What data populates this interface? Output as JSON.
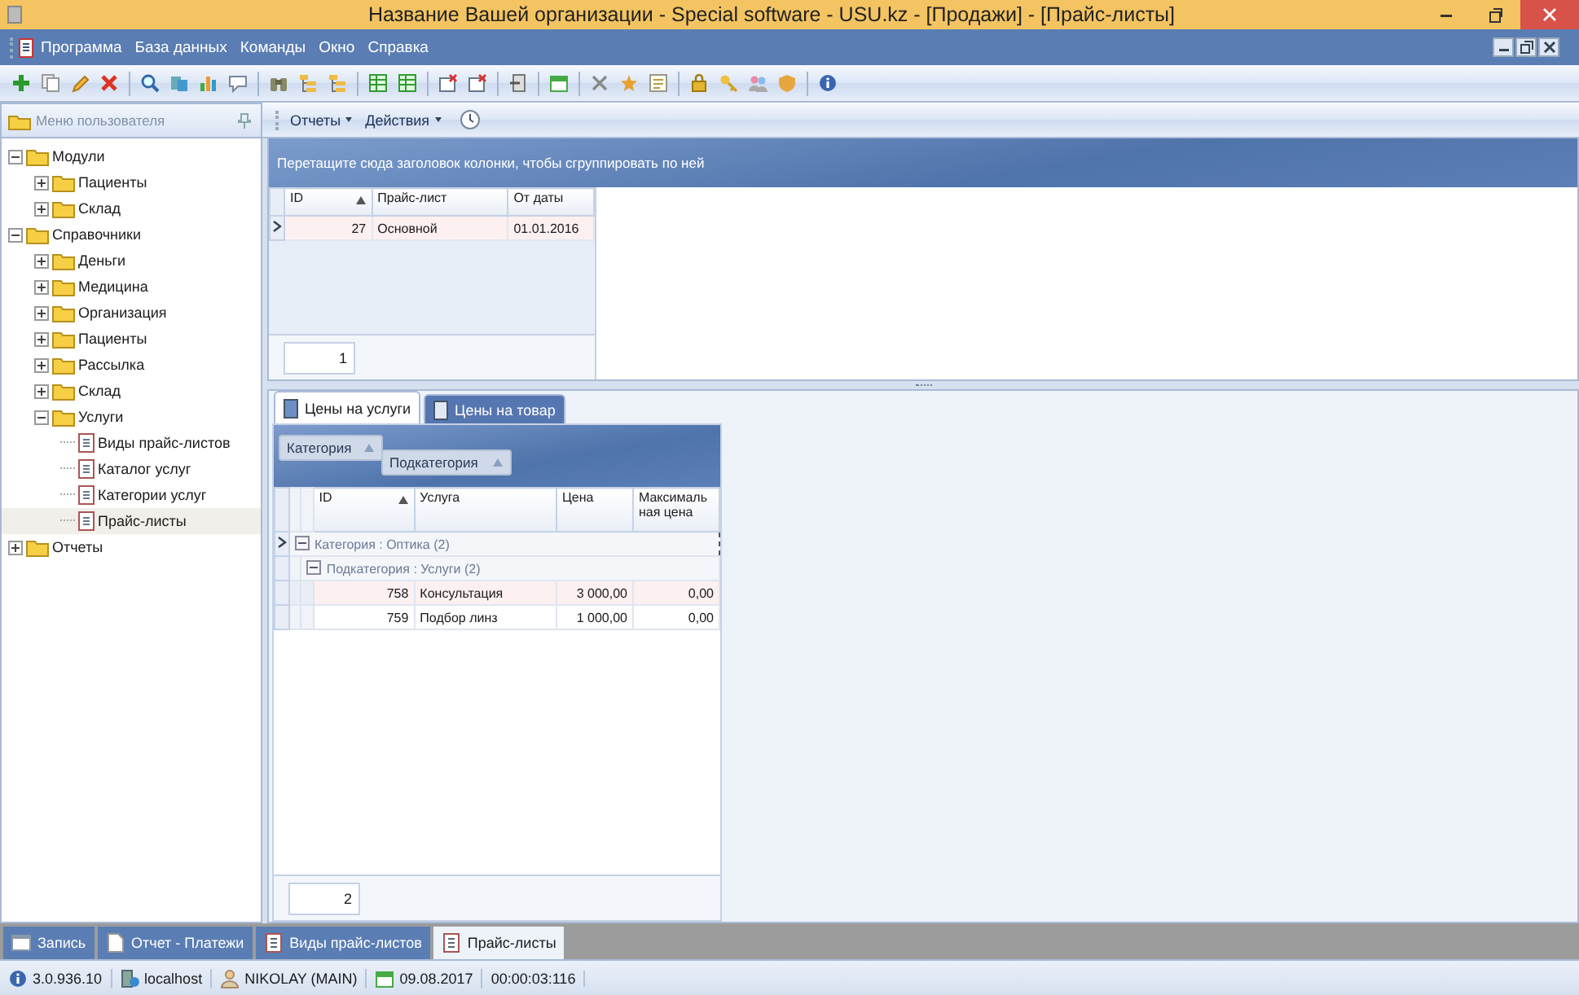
{
  "window": {
    "title": "Название Вашей организации - Special software - USU.kz - [Продажи] - [Прайс-листы]"
  },
  "menu": [
    "Программа",
    "База данных",
    "Команды",
    "Окно",
    "Справка"
  ],
  "side_panel": {
    "title": "Меню пользователя",
    "tree": [
      {
        "label": "Модули",
        "kind": "folder",
        "expanded": true,
        "selected": false,
        "children": [
          {
            "label": "Пациенты",
            "kind": "folder",
            "expanded": false,
            "selected": false
          },
          {
            "label": "Склад",
            "kind": "folder",
            "expanded": false,
            "selected": false
          }
        ]
      },
      {
        "label": "Справочники",
        "kind": "folder",
        "expanded": true,
        "selected": false,
        "children": [
          {
            "label": "Деньги",
            "kind": "folder",
            "expanded": false,
            "selected": false
          },
          {
            "label": "Медицина",
            "kind": "folder",
            "expanded": false,
            "selected": false
          },
          {
            "label": "Организация",
            "kind": "folder",
            "expanded": false,
            "selected": false
          },
          {
            "label": "Пациенты",
            "kind": "folder",
            "expanded": false,
            "selected": false
          },
          {
            "label": "Рассылка",
            "kind": "folder",
            "expanded": false,
            "selected": false
          },
          {
            "label": "Склад",
            "kind": "folder",
            "expanded": false,
            "selected": false
          },
          {
            "label": "Услуги",
            "kind": "folder",
            "expanded": true,
            "selected": false,
            "children": [
              {
                "label": "Виды прайс-листов",
                "kind": "document",
                "selected": false
              },
              {
                "label": "Каталог услуг",
                "kind": "document",
                "selected": false
              },
              {
                "label": "Категории услуг",
                "kind": "document",
                "selected": false
              },
              {
                "label": "Прайс-листы",
                "kind": "document",
                "selected": true
              }
            ]
          }
        ]
      },
      {
        "label": "Отчеты",
        "kind": "folder",
        "expanded": false,
        "selected": false
      }
    ]
  },
  "sub_toolbar": [
    "Отчеты",
    "Действия"
  ],
  "price_lists": {
    "group_hint": "Перетащите сюда заголовок колонки, чтобы сгруппировать по ней",
    "columns": [
      "ID",
      "Прайс-лист",
      "От даты"
    ],
    "rows": [
      {
        "cells": [
          "27",
          "Основной",
          "01.01.2016"
        ],
        "selected": true
      }
    ],
    "count": "1"
  },
  "detail_tabs": [
    {
      "label": "Цены на услуги",
      "selected": true
    },
    {
      "label": "Цены на товар",
      "selected": false
    }
  ],
  "prices": {
    "group_by": [
      "Категория",
      "Подкатегория"
    ],
    "columns": [
      "ID",
      "Услуга",
      "Цена",
      "Максимальная цена"
    ],
    "groups": [
      {
        "label": "Категория : Оптика (2)",
        "expanded": true,
        "subgroups": [
          {
            "label": "Подкатегория : Услуги (2)",
            "expanded": true,
            "rows": [
              {
                "cells": [
                  "758",
                  "Консультация",
                  "3 000,00",
                  "0,00"
                ],
                "selected": true
              },
              {
                "cells": [
                  "759",
                  "Подбор линз",
                  "1 000,00",
                  "0,00"
                ],
                "selected": false
              }
            ]
          }
        ]
      }
    ],
    "count": "2"
  },
  "taskbar": [
    {
      "label": "Запись",
      "kind": "window",
      "selected": false
    },
    {
      "label": "Отчет - Платежи",
      "kind": "page",
      "selected": false
    },
    {
      "label": "Виды прайс-листов",
      "kind": "list",
      "selected": false
    },
    {
      "label": "Прайс-листы",
      "kind": "list",
      "selected": true
    }
  ],
  "status_bar": [
    {
      "text": "3.0.936.10",
      "kind": "info"
    },
    {
      "text": "localhost",
      "kind": "server"
    },
    {
      "text": "NIKOLAY (MAIN)",
      "kind": "user"
    },
    {
      "text": "09.08.2017",
      "kind": "calendar"
    },
    {
      "text": "00:00:03:116",
      "kind": "none"
    }
  ]
}
